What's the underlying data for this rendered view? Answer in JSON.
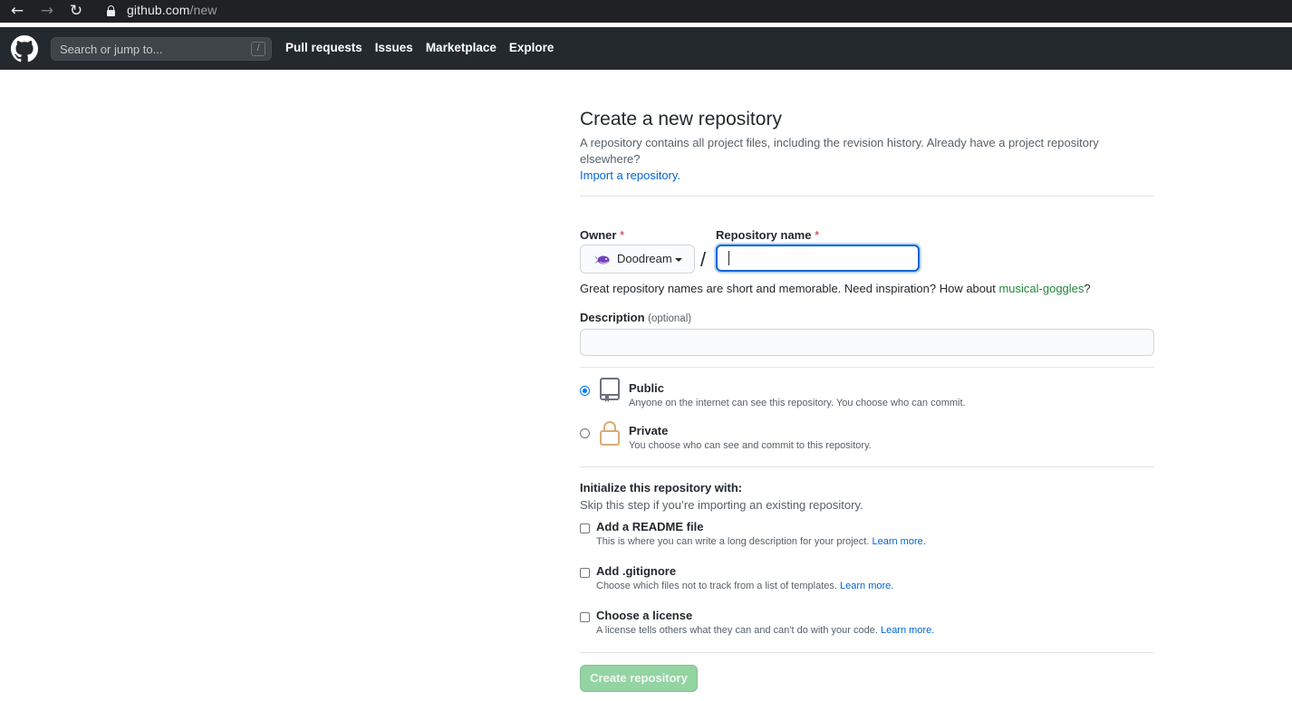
{
  "browser": {
    "url_host": "github.com",
    "url_path": "/new",
    "icons": {
      "back": "back-arrow-icon",
      "forward": "forward-arrow-icon",
      "reload": "reload-icon",
      "lock": "lock-icon"
    }
  },
  "header": {
    "search_placeholder": "Search or jump to...",
    "search_shortcut": "/",
    "nav": [
      "Pull requests",
      "Issues",
      "Marketplace",
      "Explore"
    ],
    "background": "#24292e"
  },
  "page": {
    "title": "Create a new repository",
    "description": "A repository contains all project files, including the revision history. Already have a project repository elsewhere?",
    "import_link": "Import a repository."
  },
  "form": {
    "owner_label": "Owner",
    "owner_required": "*",
    "owner_value": "Doodream",
    "slash": "/",
    "repo_label": "Repository name",
    "repo_required": "*",
    "repo_value": "",
    "hint_text": "Great repository names are short and memorable. Need inspiration? How about ",
    "hint_suggestion": "musical-goggles",
    "hint_end": "?",
    "description_label": "Description",
    "description_optional": "(optional)",
    "description_value": ""
  },
  "visibility": {
    "selected": "Public",
    "options": [
      {
        "title": "Public",
        "note": "Anyone on the internet can see this repository. You choose who can commit.",
        "icon": "repo-book-icon"
      },
      {
        "title": "Private",
        "note": "You choose who can see and commit to this repository.",
        "icon": "lock-icon"
      }
    ]
  },
  "initialize": {
    "heading": "Initialize this repository with:",
    "subheading": "Skip this step if you’re importing an existing repository.",
    "options": [
      {
        "title": "Add a README file",
        "note": "This is where you can write a long description for your project.",
        "link": "Learn more.",
        "checked": false
      },
      {
        "title": "Add .gitignore",
        "note": "Choose which files not to track from a list of templates.",
        "link": "Learn more.",
        "checked": false
      },
      {
        "title": "Choose a license",
        "note": "A license tells others what they can and can't do with your code.",
        "link": "Learn more.",
        "checked": false
      }
    ]
  },
  "submit": {
    "label": "Create repository",
    "color": "#94d3a2",
    "enabled": false
  },
  "colors": {
    "link": "#0366d6",
    "required": "#cb2431",
    "suggestion": "#22863a",
    "focus": "#0366d6"
  }
}
